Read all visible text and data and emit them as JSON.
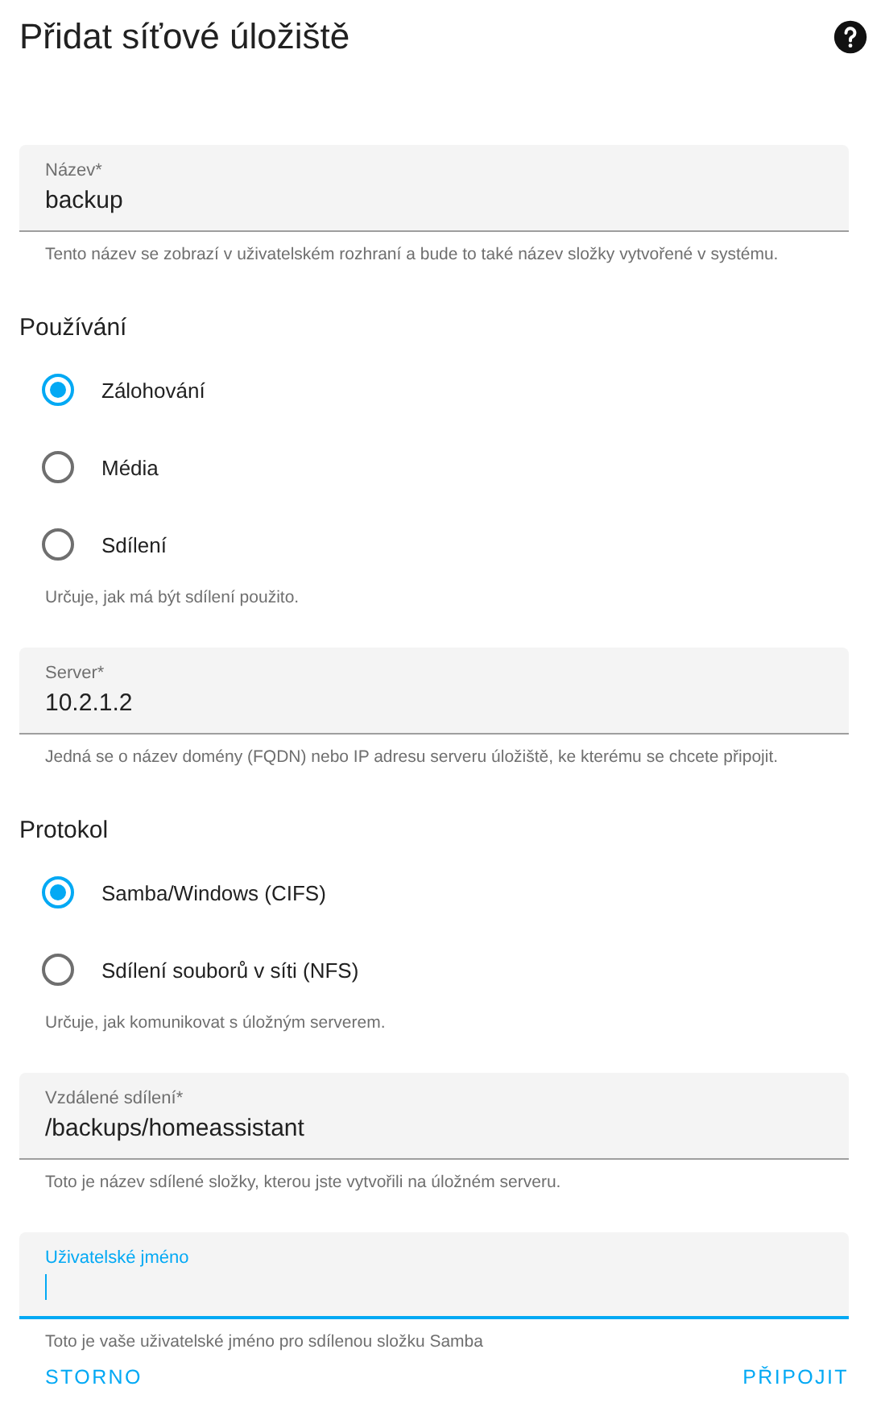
{
  "dialog": {
    "title": "Přidat síťové úložiště"
  },
  "sections": [
    {
      "kind": "field",
      "label": "Název*",
      "value": "backup",
      "focused": false,
      "helper": "Tento název se zobrazí v uživatelském rozhraní a bude to také název složky vytvořené v systému."
    },
    {
      "kind": "radio_group",
      "title": "Používání",
      "options": [
        {
          "label": "Zálohování",
          "selected": true
        },
        {
          "label": "Média",
          "selected": false
        },
        {
          "label": "Sdílení",
          "selected": false
        }
      ],
      "helper": "Určuje, jak má být sdílení použito."
    },
    {
      "kind": "field",
      "label": "Server*",
      "value": "10.2.1.2",
      "focused": false,
      "helper": "Jedná se o název domény (FQDN) nebo IP adresu serveru úložiště, ke kterému se chcete připojit."
    },
    {
      "kind": "radio_group",
      "title": "Protokol",
      "options": [
        {
          "label": "Samba/Windows (CIFS)",
          "selected": true
        },
        {
          "label": "Sdílení souborů v síti (NFS)",
          "selected": false
        }
      ],
      "helper": "Určuje, jak komunikovat s úložným serverem."
    },
    {
      "kind": "field",
      "label": "Vzdálené sdílení*",
      "value": "/backups/homeassistant",
      "focused": false,
      "helper": "Toto je název sdílené složky, kterou jste vytvořili na úložném serveru."
    },
    {
      "kind": "field",
      "label": "Uživatelské jméno",
      "focused": true,
      "helper": "Toto je vaše uživatelské jméno pro sdílenou složku Samba"
    }
  ],
  "buttons": [
    {
      "label": "STORNO"
    },
    {
      "label": "PŘIPOJIT"
    }
  ]
}
